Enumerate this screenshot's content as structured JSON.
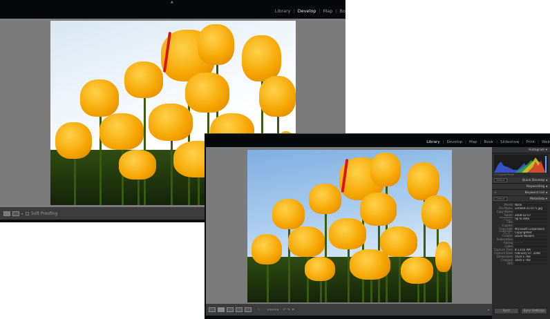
{
  "window1": {
    "modules": [
      "Library",
      "Develop",
      "Map",
      "Bo"
    ],
    "active_module": "Develop",
    "toolbar": {
      "soft_proofing_label": "Soft Proofing"
    }
  },
  "window2": {
    "modules": [
      "Library",
      "Develop",
      "Map",
      "Book",
      "Slideshow",
      "Print",
      "Web"
    ],
    "active_module": "Library",
    "toolbar": {
      "rating": "★★★★★"
    },
    "panel": {
      "histogram": "Histogram",
      "original_photo": "Original Photo",
      "quick_develop": "Quick Develop",
      "quick_develop_preset": "Default",
      "keywording": "Keywording",
      "keyword_list": "Keyword List",
      "keyword_add": "+",
      "metadata": "Metadata",
      "metadata_preset": "Default",
      "preset_label": "Preset",
      "preset_value": "None",
      "fields": [
        {
          "k": "File Name",
          "v": "untitled-21-07-5.jpg"
        },
        {
          "k": "Copy Name",
          "v": ""
        },
        {
          "k": "Folder",
          "v": "2008-02-07"
        },
        {
          "k": "Metadata Status",
          "v": "Up to date"
        },
        {
          "k": "Title",
          "v": ""
        },
        {
          "k": "Caption",
          "v": ""
        },
        {
          "k": "Copyright",
          "v": "Microsoft Corporation"
        },
        {
          "k": "Copyright Status",
          "v": "Copyrighted"
        },
        {
          "k": "Creator",
          "v": "David Nadalin"
        },
        {
          "k": "Sublocation",
          "v": ""
        },
        {
          "k": "Rating",
          "v": "· · · · ·"
        },
        {
          "k": "Label",
          "v": ""
        },
        {
          "k": "Capture Time",
          "v": "8:13:02 AM"
        },
        {
          "k": "Capture Date",
          "v": "February 07, 2008"
        },
        {
          "k": "Dimensions",
          "v": "1024 x 768"
        },
        {
          "k": "Cropped",
          "v": "1024 x 768"
        },
        {
          "k": "GPS",
          "v": ""
        }
      ],
      "sync": "Sync",
      "sync_settings": "Sync Settings"
    }
  },
  "colors": {
    "accent": "#f5a400",
    "panel": "#2b2b2b",
    "canvas": "#7b7b7b"
  }
}
